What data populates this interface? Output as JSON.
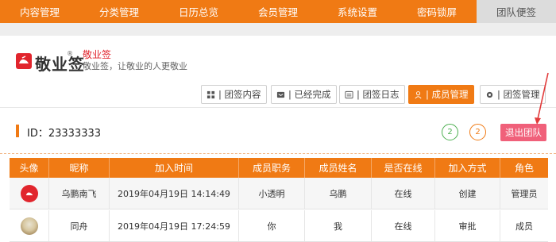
{
  "nav": {
    "items": [
      "内容管理",
      "分类管理",
      "日历总览",
      "会员管理",
      "系统设置",
      "密码锁屏",
      "团队便签"
    ],
    "active_index": 6
  },
  "team": {
    "logo_text": "敬业签",
    "logo_reg": "®",
    "name": "敬业签",
    "slogan": "敬业签，让敬业的人更敬业"
  },
  "toolbar": {
    "content_label": "| 团签内容",
    "done_label": "| 已经完成",
    "log_label": "| 团签日志",
    "members_label": "| 成员管理",
    "manage_label": "| 团签管理"
  },
  "id_bar": {
    "id_text": "ID：23333333",
    "badge_green": "2",
    "badge_orange": "2",
    "exit_label": "退出团队"
  },
  "colors": {
    "accent": "#f07a14",
    "exit": "#f0607a",
    "brand": "#e1252d"
  },
  "table": {
    "headers": [
      "头像",
      "昵称",
      "加入时间",
      "成员职务",
      "成员姓名",
      "是否在线",
      "加入方式",
      "角色"
    ],
    "rows": [
      {
        "avatar": "app-logo-avatar",
        "nickname": "乌鹏南飞",
        "join_time": "2019年04月19日 14:14:49",
        "position": "小透明",
        "name": "乌鹏",
        "online": "在线",
        "join_method": "创建",
        "role": "管理员"
      },
      {
        "avatar": "photo-avatar",
        "nickname": "同舟",
        "join_time": "2019年04月19日 17:24:59",
        "position": "你",
        "name": "我",
        "online": "在线",
        "join_method": "审批",
        "role": "成员"
      }
    ]
  }
}
